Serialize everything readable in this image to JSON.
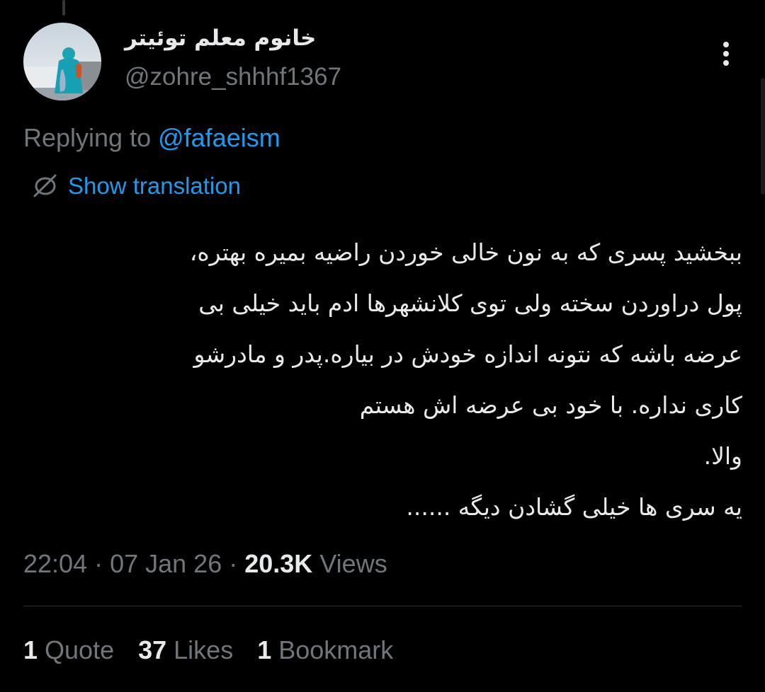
{
  "author": {
    "display_name": "خانوم معلم توئیتر",
    "handle": "@zohre_shhhf1367"
  },
  "reply": {
    "prefix": "Replying to ",
    "mention": "@fafaeism"
  },
  "translation": {
    "label": "Show translation",
    "icon": "translate-globe-icon"
  },
  "tweet": {
    "lines": [
      "ببخشید پسری که به نون خالی خوردن راضیه بمیره بهتره،",
      "پول دراوردن سخته ولی توی کلانشهرها ادم باید خیلی بی",
      "عرضه باشه که نتونه اندازه خودش در بیاره.پدر و مادرشو",
      "کاری نداره. با خود بی عرضه اش هستم",
      "والا.",
      "یه سری ها خیلی گشادن دیگه ......"
    ]
  },
  "meta": {
    "time": "22:04",
    "separator": " · ",
    "date": "07 Jan 26",
    "views_count": "20.3K",
    "views_label": " Views"
  },
  "stats": {
    "quotes_count": "1",
    "quotes_label": " Quote",
    "likes_count": "37",
    "likes_label": " Likes",
    "bookmarks_count": "1",
    "bookmarks_label": " Bookmark"
  },
  "colors": {
    "background": "#000000",
    "text": "#e7e9ea",
    "secondary": "#71767b",
    "accent": "#1d9bf0",
    "divider": "#2f3336"
  }
}
